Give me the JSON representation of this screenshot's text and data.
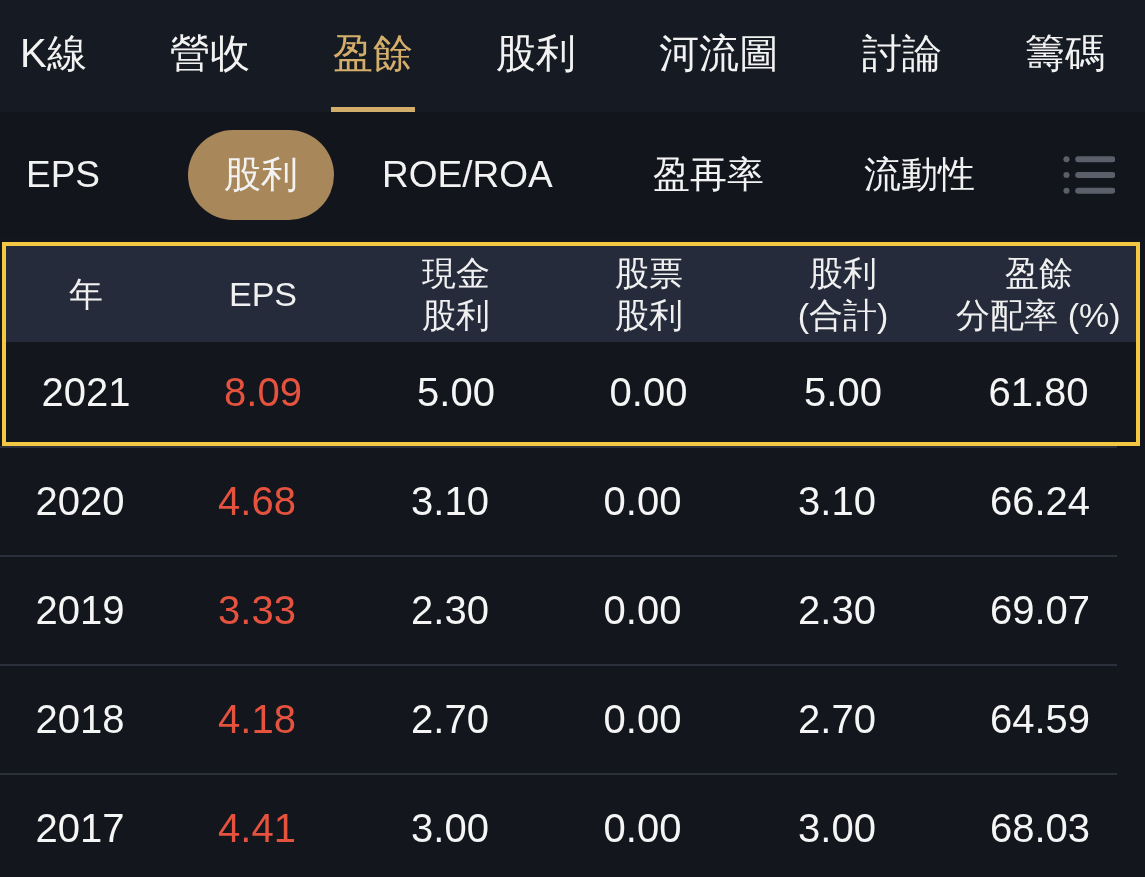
{
  "tabs": [
    {
      "label": "K線",
      "selected": false
    },
    {
      "label": "營收",
      "selected": false
    },
    {
      "label": "盈餘",
      "selected": true
    },
    {
      "label": "股利",
      "selected": false
    },
    {
      "label": "河流圖",
      "selected": false
    },
    {
      "label": "討論",
      "selected": false
    },
    {
      "label": "籌碼",
      "selected": false
    }
  ],
  "subtabs": [
    {
      "label": "EPS",
      "selected": false
    },
    {
      "label": "股利",
      "selected": true
    },
    {
      "label": "ROE/ROA",
      "selected": false
    },
    {
      "label": "盈再率",
      "selected": false
    },
    {
      "label": "流動性",
      "selected": false
    }
  ],
  "table": {
    "outlined": true,
    "columns": [
      {
        "lines": [
          "年"
        ]
      },
      {
        "lines": [
          "EPS"
        ]
      },
      {
        "lines": [
          "現金",
          "股利"
        ]
      },
      {
        "lines": [
          "股票",
          "股利"
        ]
      },
      {
        "lines": [
          "股利",
          "(合計)"
        ]
      },
      {
        "lines": [
          "盈餘",
          "分配率 (%)"
        ]
      }
    ],
    "rows": [
      [
        "2021",
        "8.09",
        "5.00",
        "0.00",
        "5.00",
        "61.80"
      ],
      [
        "2020",
        "4.68",
        "3.10",
        "0.00",
        "3.10",
        "66.24"
      ],
      [
        "2019",
        "3.33",
        "2.30",
        "0.00",
        "2.30",
        "69.07"
      ],
      [
        "2018",
        "4.18",
        "2.70",
        "0.00",
        "2.70",
        "64.59"
      ],
      [
        "2017",
        "4.41",
        "3.00",
        "0.00",
        "3.00",
        "68.03"
      ]
    ]
  }
}
